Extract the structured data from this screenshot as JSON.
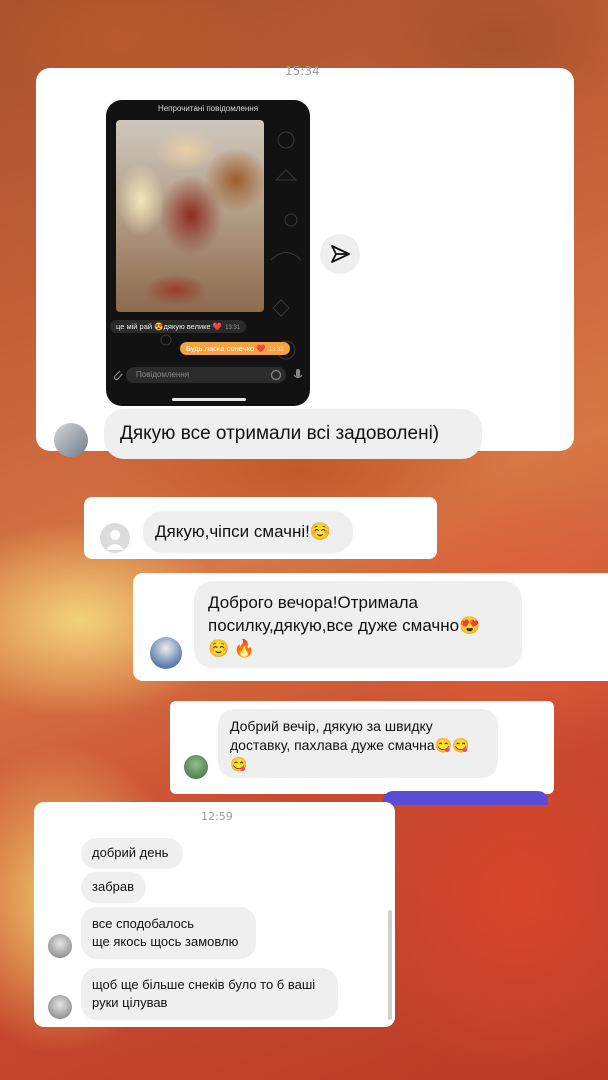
{
  "card1": {
    "time": "15:34",
    "story": {
      "header": "Непрочитані повідомлення",
      "incoming_text": "це мій рай 😍дякую велике ❤️",
      "incoming_time": "13:31",
      "outgoing_text": "Будь ласка сонечко ❤️",
      "outgoing_time": "13:33",
      "input_placeholder": "Повідомлення"
    },
    "message": "Дякую все отримали всі задоволені)"
  },
  "card2": {
    "message": "Дякую,чіпси смачні!☺️"
  },
  "card3": {
    "message_line1": "Доброго вечора!Отримала",
    "message_line2": "посилку,дякую,все дуже смачно😍",
    "message_line3": "☺️ 🔥"
  },
  "card4": {
    "message_line1": "Добрий вечір, дякую за швидку",
    "message_line2": "доставку, пахлава дуже смачна😋😋",
    "message_line3": "😋"
  },
  "card5": {
    "time": "12:59",
    "messages": [
      {
        "line1": "добрий день"
      },
      {
        "line1": "забрав"
      },
      {
        "line1": "все сподобалось",
        "line2": "ще якось щось замовлю"
      },
      {
        "line1": "щоб ще більше снеків було то б ваші",
        "line2": "руки цілував"
      }
    ]
  },
  "colors": {
    "card": "#ffffff",
    "bubble": "#efefef",
    "outgoing": "#f4a340",
    "accent_tab": "#5b4cd8"
  }
}
